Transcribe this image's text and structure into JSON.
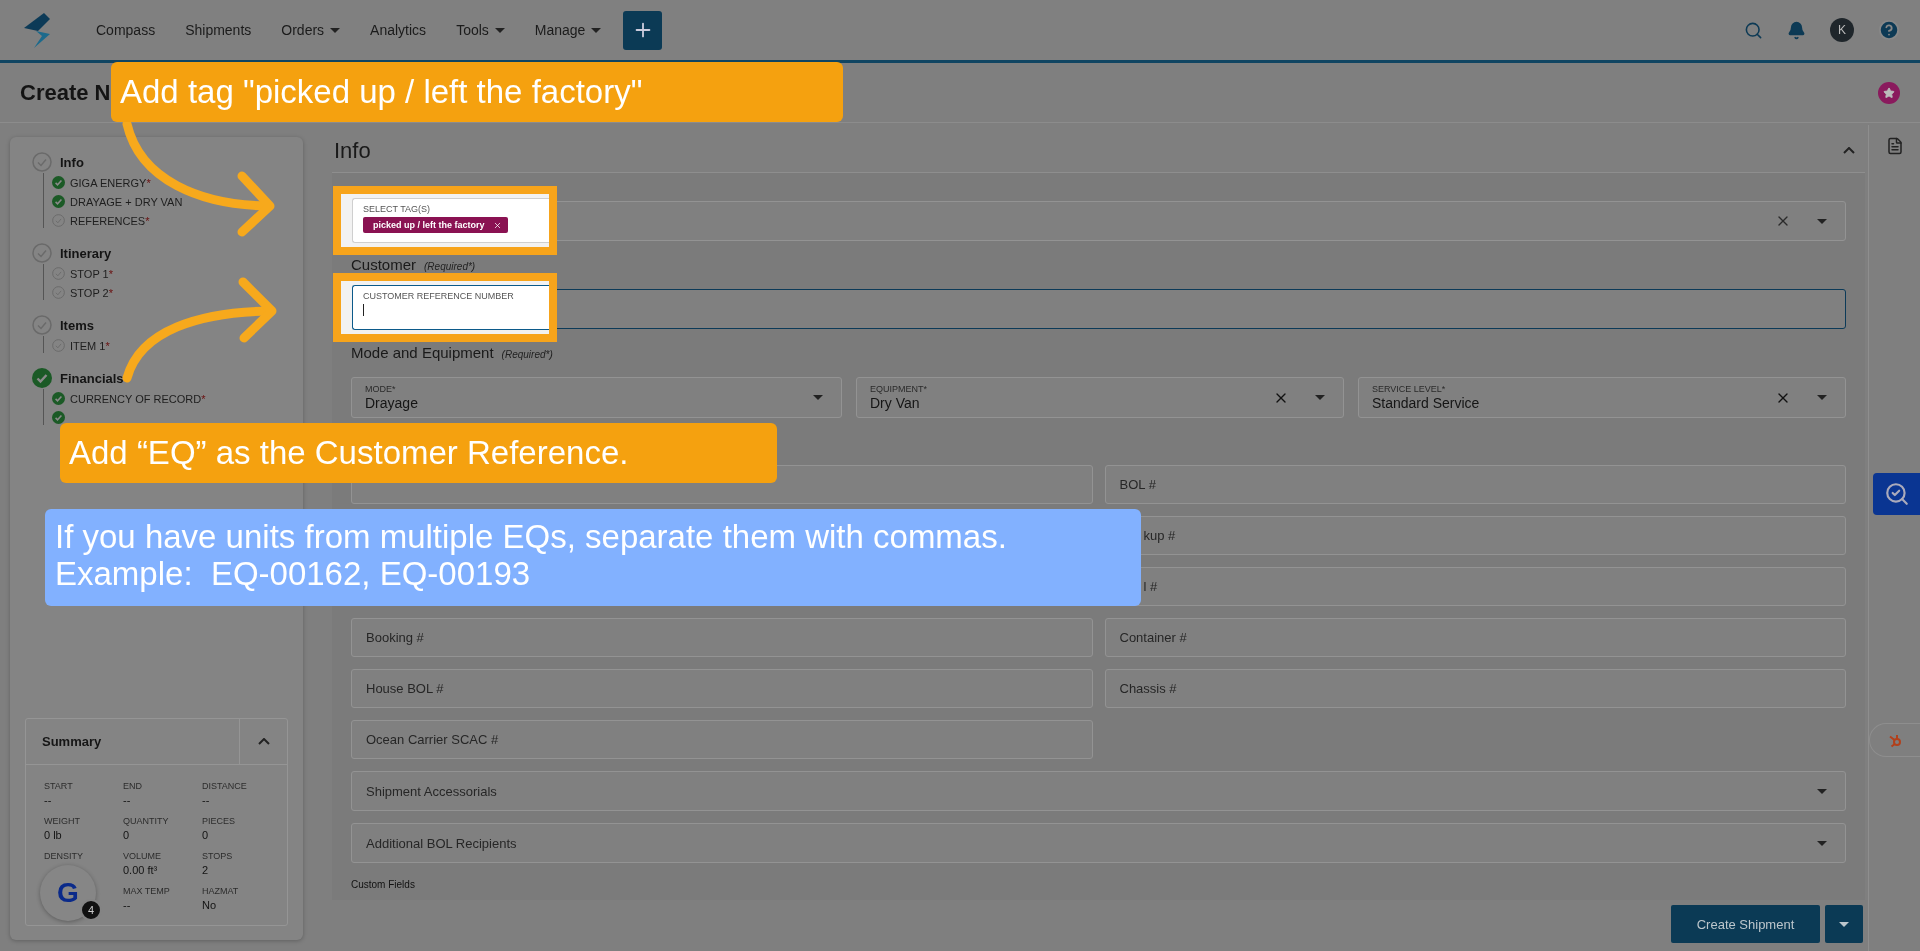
{
  "nav": {
    "items": [
      {
        "label": "Compass",
        "has_menu": false
      },
      {
        "label": "Shipments",
        "has_menu": false
      },
      {
        "label": "Orders",
        "has_menu": true
      },
      {
        "label": "Analytics",
        "has_menu": false
      },
      {
        "label": "Tools",
        "has_menu": true
      },
      {
        "label": "Manage",
        "has_menu": true
      }
    ],
    "avatar": "K"
  },
  "page": {
    "title": "Create N"
  },
  "callouts": [
    {
      "kind": "orange",
      "text": "Add tag \"picked up / left the factory\""
    },
    {
      "kind": "orange",
      "text": "Add “EQ” as the Customer Reference."
    },
    {
      "kind": "blue",
      "text": "If you have units from multiple EQs, separate them with commas.\nExample:  EQ-00162, EQ-00193"
    }
  ],
  "steps": [
    {
      "label": "Info",
      "done": false,
      "children": [
        {
          "label": "GIGA ENERGY",
          "mark": "*",
          "done": true
        },
        {
          "label": "DRAYAGE + DRY VAN",
          "done": true
        },
        {
          "label": "REFERENCES",
          "mark": "*",
          "done": false
        }
      ]
    },
    {
      "label": "Itinerary",
      "done": false,
      "children": [
        {
          "label": "STOP 1",
          "mark": "*",
          "done": false
        },
        {
          "label": "STOP 2",
          "mark": "*",
          "done": false
        }
      ]
    },
    {
      "label": "Items",
      "done": false,
      "children": [
        {
          "label": "ITEM 1",
          "mark": "*",
          "done": false
        }
      ]
    },
    {
      "label": "Financials",
      "done": true,
      "children": [
        {
          "label": "CURRENCY OF RECORD",
          "mark": "*",
          "done": true
        },
        {
          "done": true
        }
      ]
    }
  ],
  "summary": {
    "title": "Summary",
    "expanded": true,
    "cells": [
      {
        "label": "START",
        "value": "--"
      },
      {
        "label": "END",
        "value": "--"
      },
      {
        "label": "DISTANCE",
        "value": "--"
      },
      {
        "label": "WEIGHT",
        "value": "0 lb"
      },
      {
        "label": "QUANTITY",
        "value": "0"
      },
      {
        "label": "PIECES",
        "value": "0"
      },
      {
        "label": "DENSITY"
      },
      {
        "label": "VOLUME",
        "value": "0.00 ft³"
      },
      {
        "label": "STOPS",
        "value": "2"
      },
      {},
      {
        "label": "MAX TEMP",
        "value": "--"
      },
      {
        "label": "HAZMAT",
        "value": "No"
      }
    ]
  },
  "chat_widget": {
    "logo": "G",
    "badge": "4"
  },
  "section": {
    "title": "Info",
    "expanded": true,
    "tag_field": {
      "label": "SELECT TAG(S)",
      "tags": [
        "picked up / left the factory"
      ]
    },
    "customer": {
      "heading": "Customer",
      "note": "(Required*)"
    },
    "reference_field": {
      "label": "CUSTOMER REFERENCE NUMBER",
      "focused": true
    },
    "mode": {
      "heading": "Mode and Equipment",
      "note": "(Required*)"
    },
    "selects": [
      {
        "label": "MODE*",
        "value": "Drayage",
        "clearable": false
      },
      {
        "label": "EQUIPMENT*",
        "value": "Dry Van",
        "clearable": true
      },
      {
        "label": "SERVICE LEVEL*",
        "value": "Standard Service",
        "clearable": true
      }
    ],
    "fields": [
      {
        "kind": "hidden"
      },
      {
        "placeholder": "BOL #",
        "kind": "text"
      },
      {
        "placeholder": "kup #",
        "kind": "partial"
      },
      {
        "placeholder": "l #",
        "kind": "partial"
      },
      {
        "placeholder": "Booking #",
        "kind": "text"
      },
      {
        "placeholder": "Container #",
        "kind": "text"
      },
      {
        "placeholder": "House BOL #",
        "kind": "text"
      },
      {
        "placeholder": "Chassis #",
        "kind": "text"
      },
      {
        "placeholder": "Ocean Carrier SCAC #",
        "kind": "text"
      }
    ],
    "dropdowns": [
      "Shipment Accessorials",
      "Additional BOL Recipients"
    ],
    "custom_fields": "Custom Fields"
  },
  "actions": {
    "primary": "Create Shipment"
  }
}
